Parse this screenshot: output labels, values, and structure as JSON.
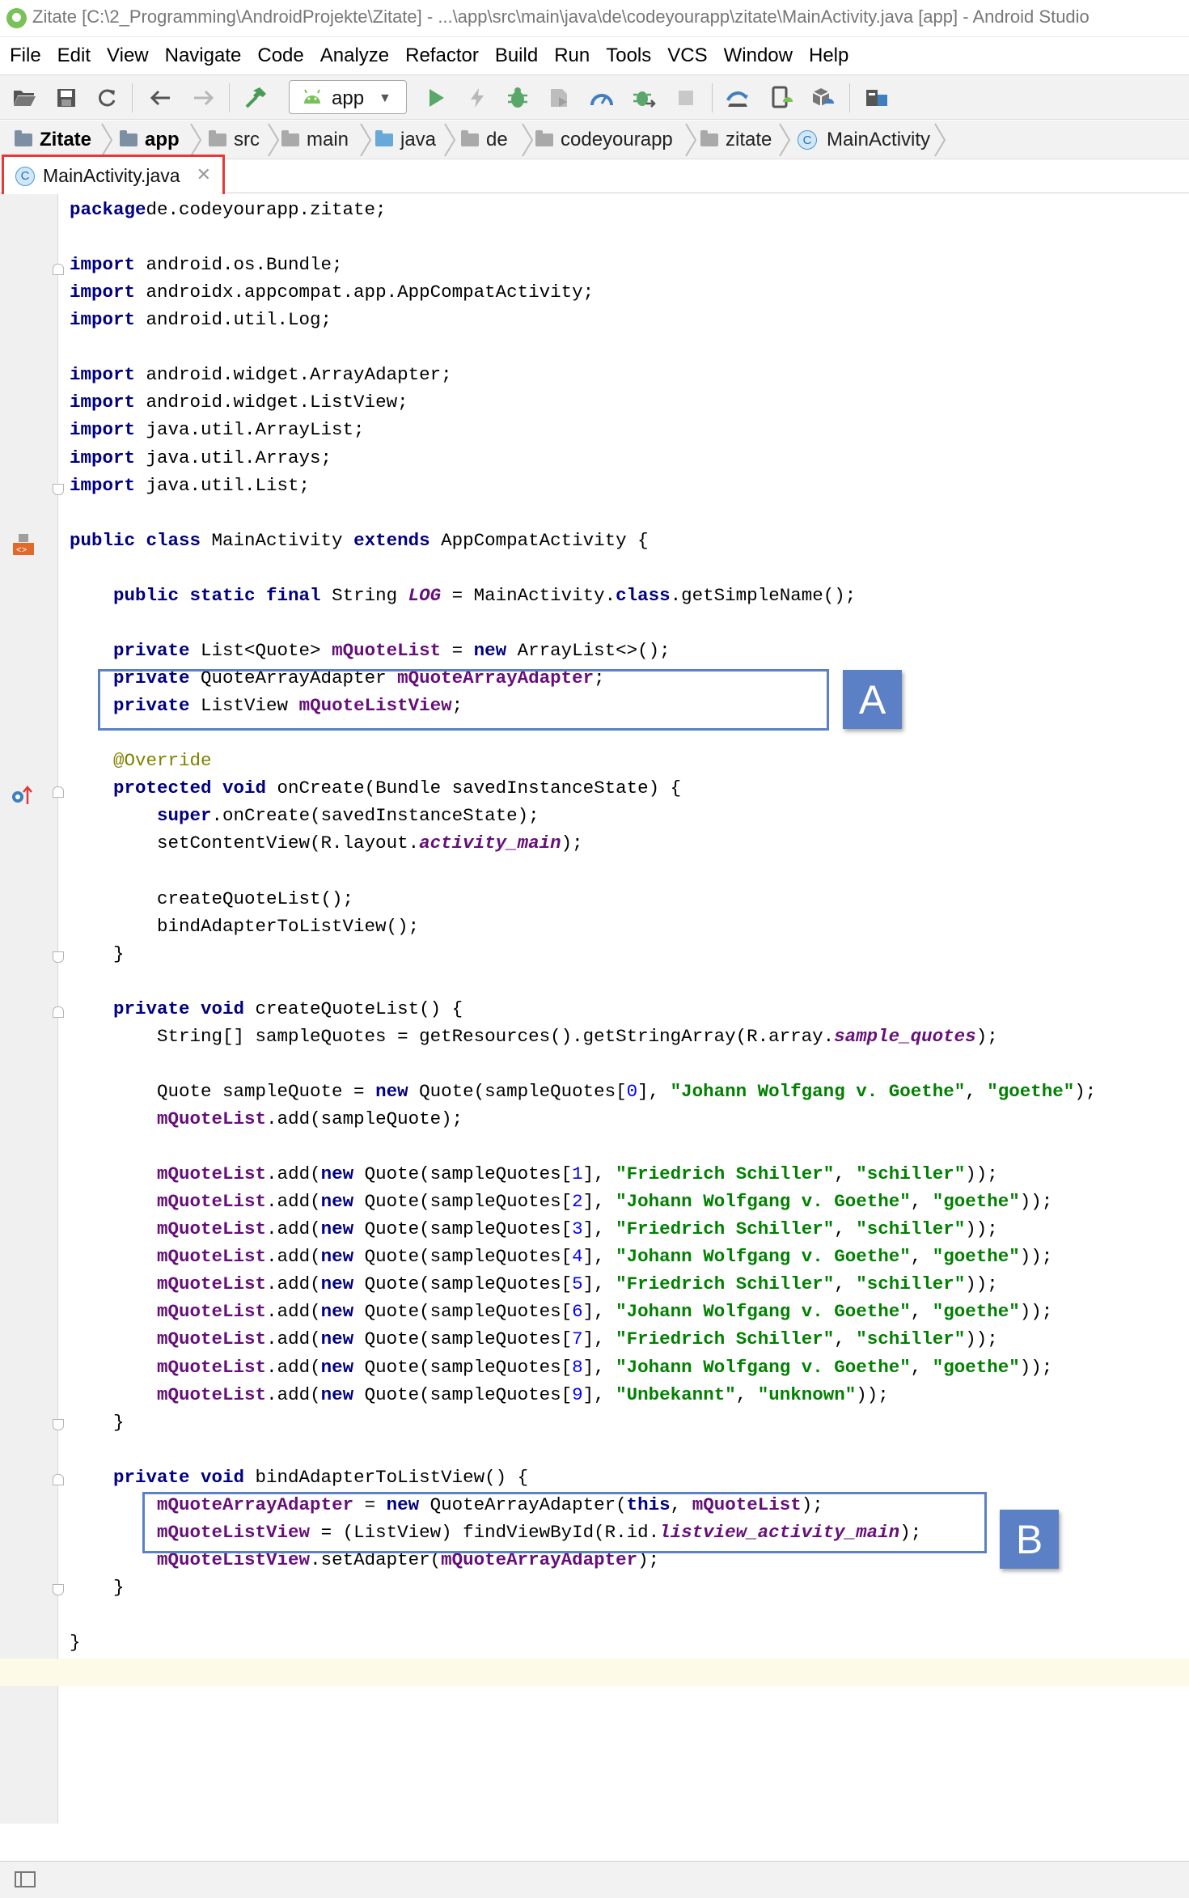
{
  "window": {
    "title": "Zitate [C:\\2_Programming\\AndroidProjekte\\Zitate] - ...\\app\\src\\main\\java\\de\\codeyourapp\\zitate\\MainActivity.java [app] - Android Studio"
  },
  "menu": {
    "items": [
      "File",
      "Edit",
      "View",
      "Navigate",
      "Code",
      "Analyze",
      "Refactor",
      "Build",
      "Run",
      "Tools",
      "VCS",
      "Window",
      "Help"
    ]
  },
  "toolbar": {
    "run_config": "app",
    "icons": [
      "open-icon",
      "save-icon",
      "sync-icon",
      "back-icon",
      "forward-icon",
      "build-hammer-icon",
      "run-icon",
      "apply-changes-icon",
      "debug-icon",
      "coverage-icon",
      "profile-icon",
      "attach-debugger-icon",
      "stop-icon",
      "gradle-sync-icon",
      "avd-manager-icon",
      "sdk-manager-icon",
      "project-structure-icon"
    ]
  },
  "breadcrumb": {
    "items": [
      "Zitate",
      "app",
      "src",
      "main",
      "java",
      "de",
      "codeyourapp",
      "zitate",
      "MainActivity"
    ]
  },
  "tabs": [
    {
      "label": "MainActivity.java",
      "active": true
    }
  ],
  "annotations": {
    "box_a": "A",
    "box_b": "B"
  },
  "code": {
    "lines": [
      [
        [
          "kw",
          "package"
        ],
        [
          "",
          "de.codeyourapp.zitate;"
        ]
      ],
      [],
      [
        [
          "kw",
          "import"
        ],
        [
          "",
          " android.os.Bundle;"
        ]
      ],
      [
        [
          "kw",
          "import"
        ],
        [
          "",
          " androidx.appcompat.app.AppCompatActivity;"
        ]
      ],
      [
        [
          "kw",
          "import"
        ],
        [
          "",
          " android.util.Log;"
        ]
      ],
      [],
      [
        [
          "kw",
          "import"
        ],
        [
          "",
          " android.widget.ArrayAdapter;"
        ]
      ],
      [
        [
          "kw",
          "import"
        ],
        [
          "",
          " android.widget.ListView;"
        ]
      ],
      [
        [
          "kw",
          "import"
        ],
        [
          "",
          " java.util.ArrayList;"
        ]
      ],
      [
        [
          "kw",
          "import"
        ],
        [
          "",
          " java.util.Arrays;"
        ]
      ],
      [
        [
          "kw",
          "import"
        ],
        [
          "",
          " java.util.List;"
        ]
      ],
      [],
      [
        [
          "kw",
          "public class"
        ],
        [
          "",
          " MainActivity "
        ],
        [
          "kw",
          "extends"
        ],
        [
          "",
          " AppCompatActivity {"
        ]
      ],
      [],
      [
        [
          "",
          "    "
        ],
        [
          "kw",
          "public static final"
        ],
        [
          "",
          " String "
        ],
        [
          "sfld",
          "LOG"
        ],
        [
          "",
          " = MainActivity."
        ],
        [
          "kw",
          "class"
        ],
        [
          "",
          ".getSimpleName();"
        ]
      ],
      [],
      [
        [
          "",
          "    "
        ],
        [
          "kw",
          "private"
        ],
        [
          "",
          " List<Quote> "
        ],
        [
          "fld",
          "mQuoteList"
        ],
        [
          "",
          " = "
        ],
        [
          "kw",
          "new"
        ],
        [
          "",
          " ArrayList<>();"
        ]
      ],
      [
        [
          "",
          "    "
        ],
        [
          "kw",
          "private"
        ],
        [
          "",
          " QuoteArrayAdapter "
        ],
        [
          "fld",
          "mQuoteArrayAdapter"
        ],
        [
          "",
          ";"
        ]
      ],
      [
        [
          "",
          "    "
        ],
        [
          "kw",
          "private"
        ],
        [
          "",
          " ListView "
        ],
        [
          "fld",
          "mQuoteListView"
        ],
        [
          "",
          ";"
        ]
      ],
      [],
      [
        [
          "",
          "    "
        ],
        [
          "ann",
          "@Override"
        ]
      ],
      [
        [
          "",
          "    "
        ],
        [
          "kw",
          "protected void"
        ],
        [
          "",
          " onCreate(Bundle savedInstanceState) {"
        ]
      ],
      [
        [
          "",
          "        "
        ],
        [
          "kw",
          "super"
        ],
        [
          "",
          ".onCreate(savedInstanceState);"
        ]
      ],
      [
        [
          "",
          "        setContentView(R.layout."
        ],
        [
          "sfld",
          "activity_main"
        ],
        [
          "",
          ");"
        ]
      ],
      [],
      [
        [
          "",
          "        createQuoteList();"
        ]
      ],
      [
        [
          "",
          "        bindAdapterToListView();"
        ]
      ],
      [
        [
          "",
          "    }"
        ]
      ],
      [],
      [
        [
          "",
          "    "
        ],
        [
          "kw",
          "private void"
        ],
        [
          "",
          " createQuoteList() {"
        ]
      ],
      [
        [
          "",
          "        String[] sampleQuotes = getResources().getStringArray(R.array."
        ],
        [
          "sfld",
          "sample_quotes"
        ],
        [
          "",
          ");"
        ]
      ],
      [],
      [
        [
          "",
          "        Quote sampleQuote = "
        ],
        [
          "kw",
          "new"
        ],
        [
          "",
          " Quote(sampleQuotes["
        ],
        [
          "num",
          "0"
        ],
        [
          "",
          "], "
        ],
        [
          "str",
          "\"Johann Wolfgang v. Goethe\""
        ],
        [
          "",
          ", "
        ],
        [
          "str",
          "\"goethe\""
        ],
        [
          "",
          ");"
        ]
      ],
      [
        [
          "",
          "        "
        ],
        [
          "fld",
          "mQuoteList"
        ],
        [
          "",
          ".add(sampleQuote);"
        ]
      ],
      [],
      [
        [
          "",
          "        "
        ],
        [
          "fld",
          "mQuoteList"
        ],
        [
          "",
          ".add("
        ],
        [
          "kw",
          "new"
        ],
        [
          "",
          " Quote(sampleQuotes["
        ],
        [
          "num",
          "1"
        ],
        [
          "",
          "], "
        ],
        [
          "str",
          "\"Friedrich Schiller\""
        ],
        [
          "",
          ", "
        ],
        [
          "str",
          "\"schiller\""
        ],
        [
          "",
          "));"
        ]
      ],
      [
        [
          "",
          "        "
        ],
        [
          "fld",
          "mQuoteList"
        ],
        [
          "",
          ".add("
        ],
        [
          "kw",
          "new"
        ],
        [
          "",
          " Quote(sampleQuotes["
        ],
        [
          "num",
          "2"
        ],
        [
          "",
          "], "
        ],
        [
          "str",
          "\"Johann Wolfgang v. Goethe\""
        ],
        [
          "",
          ", "
        ],
        [
          "str",
          "\"goethe\""
        ],
        [
          "",
          "));"
        ]
      ],
      [
        [
          "",
          "        "
        ],
        [
          "fld",
          "mQuoteList"
        ],
        [
          "",
          ".add("
        ],
        [
          "kw",
          "new"
        ],
        [
          "",
          " Quote(sampleQuotes["
        ],
        [
          "num",
          "3"
        ],
        [
          "",
          "], "
        ],
        [
          "str",
          "\"Friedrich Schiller\""
        ],
        [
          "",
          ", "
        ],
        [
          "str",
          "\"schiller\""
        ],
        [
          "",
          "));"
        ]
      ],
      [
        [
          "",
          "        "
        ],
        [
          "fld",
          "mQuoteList"
        ],
        [
          "",
          ".add("
        ],
        [
          "kw",
          "new"
        ],
        [
          "",
          " Quote(sampleQuotes["
        ],
        [
          "num",
          "4"
        ],
        [
          "",
          "], "
        ],
        [
          "str",
          "\"Johann Wolfgang v. Goethe\""
        ],
        [
          "",
          ", "
        ],
        [
          "str",
          "\"goethe\""
        ],
        [
          "",
          "));"
        ]
      ],
      [
        [
          "",
          "        "
        ],
        [
          "fld",
          "mQuoteList"
        ],
        [
          "",
          ".add("
        ],
        [
          "kw",
          "new"
        ],
        [
          "",
          " Quote(sampleQuotes["
        ],
        [
          "num",
          "5"
        ],
        [
          "",
          "], "
        ],
        [
          "str",
          "\"Friedrich Schiller\""
        ],
        [
          "",
          ", "
        ],
        [
          "str",
          "\"schiller\""
        ],
        [
          "",
          "));"
        ]
      ],
      [
        [
          "",
          "        "
        ],
        [
          "fld",
          "mQuoteList"
        ],
        [
          "",
          ".add("
        ],
        [
          "kw",
          "new"
        ],
        [
          "",
          " Quote(sampleQuotes["
        ],
        [
          "num",
          "6"
        ],
        [
          "",
          "], "
        ],
        [
          "str",
          "\"Johann Wolfgang v. Goethe\""
        ],
        [
          "",
          ", "
        ],
        [
          "str",
          "\"goethe\""
        ],
        [
          "",
          "));"
        ]
      ],
      [
        [
          "",
          "        "
        ],
        [
          "fld",
          "mQuoteList"
        ],
        [
          "",
          ".add("
        ],
        [
          "kw",
          "new"
        ],
        [
          "",
          " Quote(sampleQuotes["
        ],
        [
          "num",
          "7"
        ],
        [
          "",
          "], "
        ],
        [
          "str",
          "\"Friedrich Schiller\""
        ],
        [
          "",
          ", "
        ],
        [
          "str",
          "\"schiller\""
        ],
        [
          "",
          "));"
        ]
      ],
      [
        [
          "",
          "        "
        ],
        [
          "fld",
          "mQuoteList"
        ],
        [
          "",
          ".add("
        ],
        [
          "kw",
          "new"
        ],
        [
          "",
          " Quote(sampleQuotes["
        ],
        [
          "num",
          "8"
        ],
        [
          "",
          "], "
        ],
        [
          "str",
          "\"Johann Wolfgang v. Goethe\""
        ],
        [
          "",
          ", "
        ],
        [
          "str",
          "\"goethe\""
        ],
        [
          "",
          "));"
        ]
      ],
      [
        [
          "",
          "        "
        ],
        [
          "fld",
          "mQuoteList"
        ],
        [
          "",
          ".add("
        ],
        [
          "kw",
          "new"
        ],
        [
          "",
          " Quote(sampleQuotes["
        ],
        [
          "num",
          "9"
        ],
        [
          "",
          "], "
        ],
        [
          "str",
          "\"Unbekannt\""
        ],
        [
          "",
          ", "
        ],
        [
          "str",
          "\"unknown\""
        ],
        [
          "",
          "));"
        ]
      ],
      [
        [
          "",
          "    }"
        ]
      ],
      [],
      [
        [
          "",
          "    "
        ],
        [
          "kw",
          "private void"
        ],
        [
          "",
          " bindAdapterToListView() {"
        ]
      ],
      [
        [
          "",
          "        "
        ],
        [
          "fld",
          "mQuoteArrayAdapter"
        ],
        [
          "",
          " = "
        ],
        [
          "kw",
          "new"
        ],
        [
          "",
          " QuoteArrayAdapter("
        ],
        [
          "kw",
          "this"
        ],
        [
          "",
          ", "
        ],
        [
          "fld",
          "mQuoteList"
        ],
        [
          "",
          ");"
        ]
      ],
      [
        [
          "",
          "        "
        ],
        [
          "fld",
          "mQuoteListView"
        ],
        [
          "",
          " = (ListView) findViewById(R.id."
        ],
        [
          "sfld",
          "listview_activity_main"
        ],
        [
          "",
          ");"
        ]
      ],
      [
        [
          "",
          "        "
        ],
        [
          "fld",
          "mQuoteListView"
        ],
        [
          "",
          ".setAdapter("
        ],
        [
          "fld",
          "mQuoteArrayAdapter"
        ],
        [
          "",
          ");"
        ]
      ],
      [
        [
          "",
          "    }"
        ]
      ],
      [],
      [
        [
          "",
          "}"
        ]
      ],
      []
    ]
  }
}
